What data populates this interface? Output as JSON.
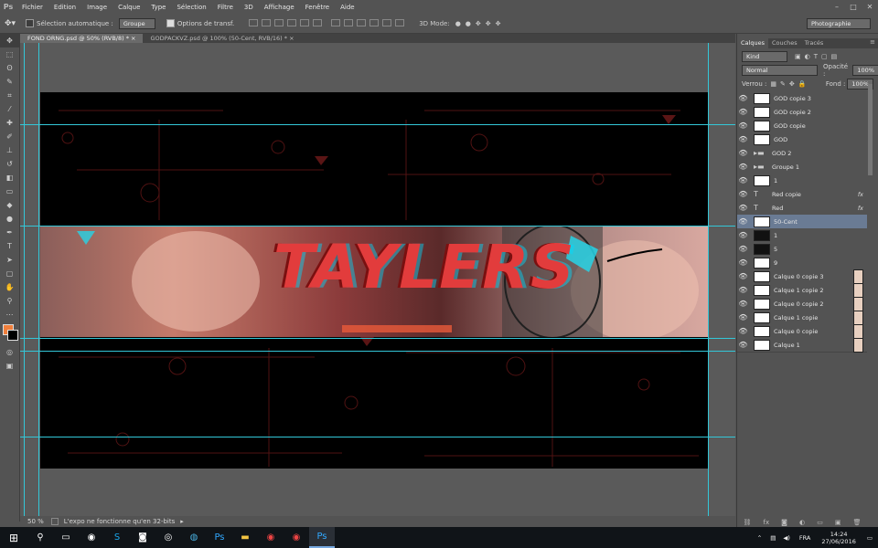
{
  "menu": {
    "items": [
      "Fichier",
      "Edition",
      "Image",
      "Calque",
      "Type",
      "Sélection",
      "Filtre",
      "3D",
      "Affichage",
      "Fenêtre",
      "Aide"
    ],
    "logo": "Ps"
  },
  "options": {
    "auto_select_label": "Sélection automatique :",
    "auto_select_value": "Groupe",
    "transform_label": "Options de transf.",
    "mode3d_label": "3D Mode:",
    "workspace": "Photographie"
  },
  "doc_tabs": [
    {
      "label": "FOND ORNG.psd @ 50% (RVB/8) *",
      "close": "×"
    },
    {
      "label": "GODPACKVZ.psd @ 100% (50-Cent, RVB/16) *",
      "close": "×"
    }
  ],
  "canvas": {
    "banner_text": "TAYLERS"
  },
  "status": {
    "zoom": "50 %",
    "message": "L'expo ne fonctionne qu'en 32-bits"
  },
  "panel": {
    "tabs": [
      "Calques",
      "Couches",
      "Tracés"
    ],
    "filter_label": "Kind",
    "blend_mode": "Normal",
    "opacity_label": "Opacité :",
    "opacity_value": "100%",
    "lock_label": "Verrou :",
    "fill_label": "Fond :",
    "fill_value": "100%",
    "layers": [
      {
        "name": "GOD copie 3",
        "kind": "thumb"
      },
      {
        "name": "GOD copie 2",
        "kind": "thumb"
      },
      {
        "name": "GOD copie",
        "kind": "thumb"
      },
      {
        "name": "GOD",
        "kind": "thumb"
      },
      {
        "name": "GOD 2",
        "kind": "folder"
      },
      {
        "name": "Groupe 1",
        "kind": "folder"
      },
      {
        "name": "1",
        "kind": "thumb"
      },
      {
        "name": "Red copie",
        "kind": "text",
        "fx": "fx"
      },
      {
        "name": "Red",
        "kind": "text",
        "fx": "fx"
      },
      {
        "name": "50-Cent",
        "kind": "thumb",
        "selected": true
      },
      {
        "name": "1",
        "kind": "dark"
      },
      {
        "name": "5",
        "kind": "dark"
      },
      {
        "name": "9",
        "kind": "thumb"
      },
      {
        "name": "Calque 0 copie 3",
        "kind": "thumb",
        "mask": true
      },
      {
        "name": "Calque 1 copie 2",
        "kind": "thumb",
        "mask": true
      },
      {
        "name": "Calque 0 copie 2",
        "kind": "thumb",
        "mask": true
      },
      {
        "name": "Calque 1 copie",
        "kind": "thumb",
        "mask": true
      },
      {
        "name": "Calque 0 copie",
        "kind": "thumb",
        "mask": true
      },
      {
        "name": "Calque 1",
        "kind": "thumb",
        "mask": true
      }
    ]
  },
  "taskbar": {
    "time": "14:24",
    "date": "27/06/2016",
    "lang": "FRA"
  }
}
